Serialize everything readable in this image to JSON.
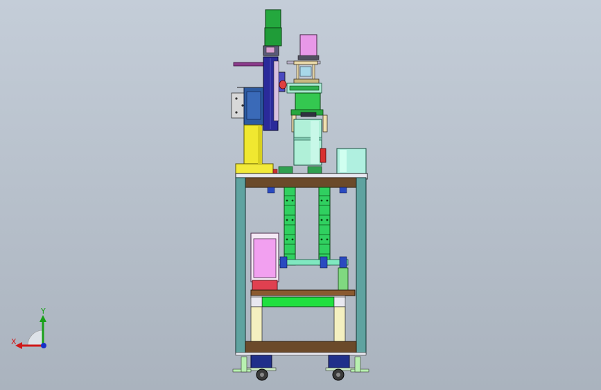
{
  "view": {
    "background_top": "#c4cdd8",
    "background_bottom": "#aab3be"
  },
  "triad": {
    "x_label": "X",
    "y_label": "Y",
    "x_color": "#d01818",
    "y_color": "#18a018",
    "z_color": "#1830c8"
  },
  "model": {
    "parts": [
      "frame",
      "table-top",
      "middle-plate",
      "bottom-plate",
      "casters",
      "left-column",
      "left-guide-rail",
      "left-cylinder",
      "right-cylinder",
      "lift-screws",
      "pink-electrical-box",
      "green-motor",
      "cup-container",
      "red-button"
    ],
    "colors": {
      "frame_teal": "#5fa3a0",
      "plate_brown": "#6b4a2a",
      "column_yellow": "#f0e830",
      "cylinder_green": "#20b040",
      "screw_green": "#30d060",
      "pink": "#f2a0f0",
      "mint": "#b0f0d8",
      "rail_navy": "#2a2a9a"
    }
  }
}
